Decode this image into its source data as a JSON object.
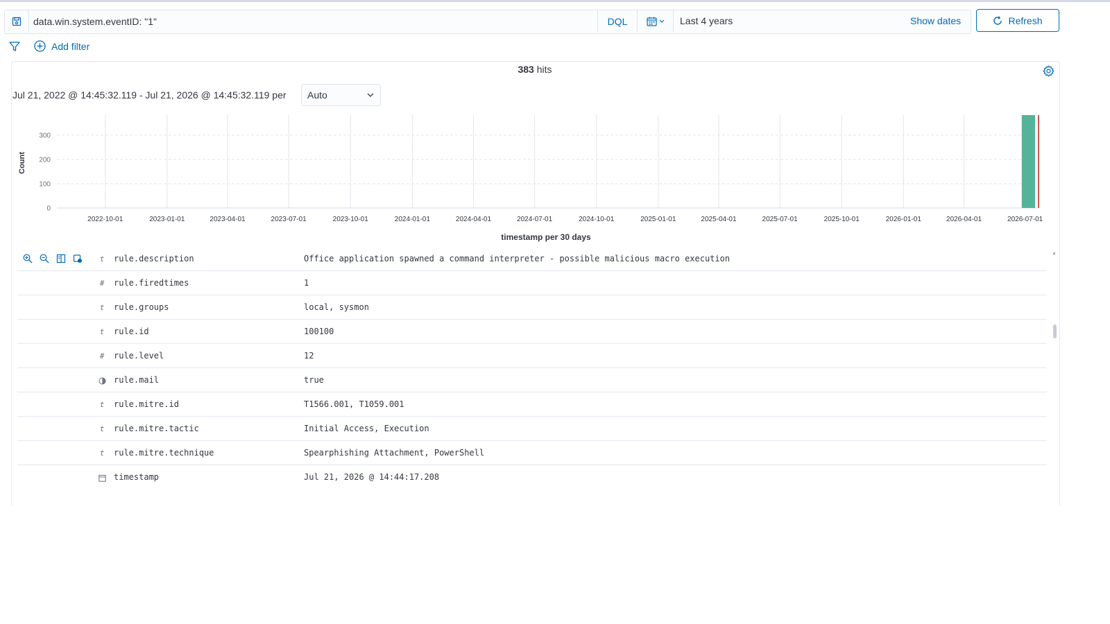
{
  "query_bar": {
    "query": "data.win.system.eventID: \"1\"",
    "language": "DQL",
    "date_range": "Last 4 years",
    "show_dates": "Show dates",
    "refresh": "Refresh"
  },
  "filters": {
    "add_filter": "Add filter"
  },
  "results": {
    "hits_count": "383",
    "hits_label": "hits",
    "interval_text": "Jul 21, 2022 @ 14:45:32.119 - Jul 21, 2026 @ 14:45:32.119 per",
    "interval_value": "Auto"
  },
  "chart_data": {
    "type": "bar",
    "ylabel": "Count",
    "xlabel": "timestamp per 30 days",
    "yticks": [
      0,
      100,
      200,
      300
    ],
    "ylim": [
      0,
      383
    ],
    "xticks": [
      "2022-10-01",
      "2023-01-01",
      "2023-04-01",
      "2023-07-01",
      "2023-10-01",
      "2024-01-01",
      "2024-04-01",
      "2024-07-01",
      "2024-10-01",
      "2025-01-01",
      "2025-04-01",
      "2025-07-01",
      "2025-10-01",
      "2026-01-01",
      "2026-04-01",
      "2026-07-01"
    ],
    "x_domain": [
      "2022-07-21",
      "2026-07-21"
    ],
    "bars": [
      {
        "start": "2026-06-26",
        "end": "2026-07-26",
        "value": 383
      }
    ],
    "now_marker": "2026-07-21",
    "bar_color": "#54b399",
    "marker_color": "#bd271e",
    "grid": true
  },
  "document": {
    "fields": [
      {
        "type": "t",
        "name": "rule.description",
        "value": "Office application spawned a command interpreter - possible malicious macro execution"
      },
      {
        "type": "#",
        "name": "rule.firedtimes",
        "value": "1"
      },
      {
        "type": "t",
        "name": "rule.groups",
        "value": "local, sysmon"
      },
      {
        "type": "t",
        "name": "rule.id",
        "value": "100100"
      },
      {
        "type": "#",
        "name": "rule.level",
        "value": "12"
      },
      {
        "type": "bool",
        "name": "rule.mail",
        "value": "true"
      },
      {
        "type": "t",
        "name": "rule.mitre.id",
        "value": "T1566.001, T1059.001"
      },
      {
        "type": "t",
        "name": "rule.mitre.tactic",
        "value": "Initial Access, Execution"
      },
      {
        "type": "t",
        "name": "rule.mitre.technique",
        "value": "Spearphishing Attachment, PowerShell"
      },
      {
        "type": "date",
        "name": "timestamp",
        "value": "Jul 21, 2026 @ 14:44:17.208"
      }
    ]
  }
}
